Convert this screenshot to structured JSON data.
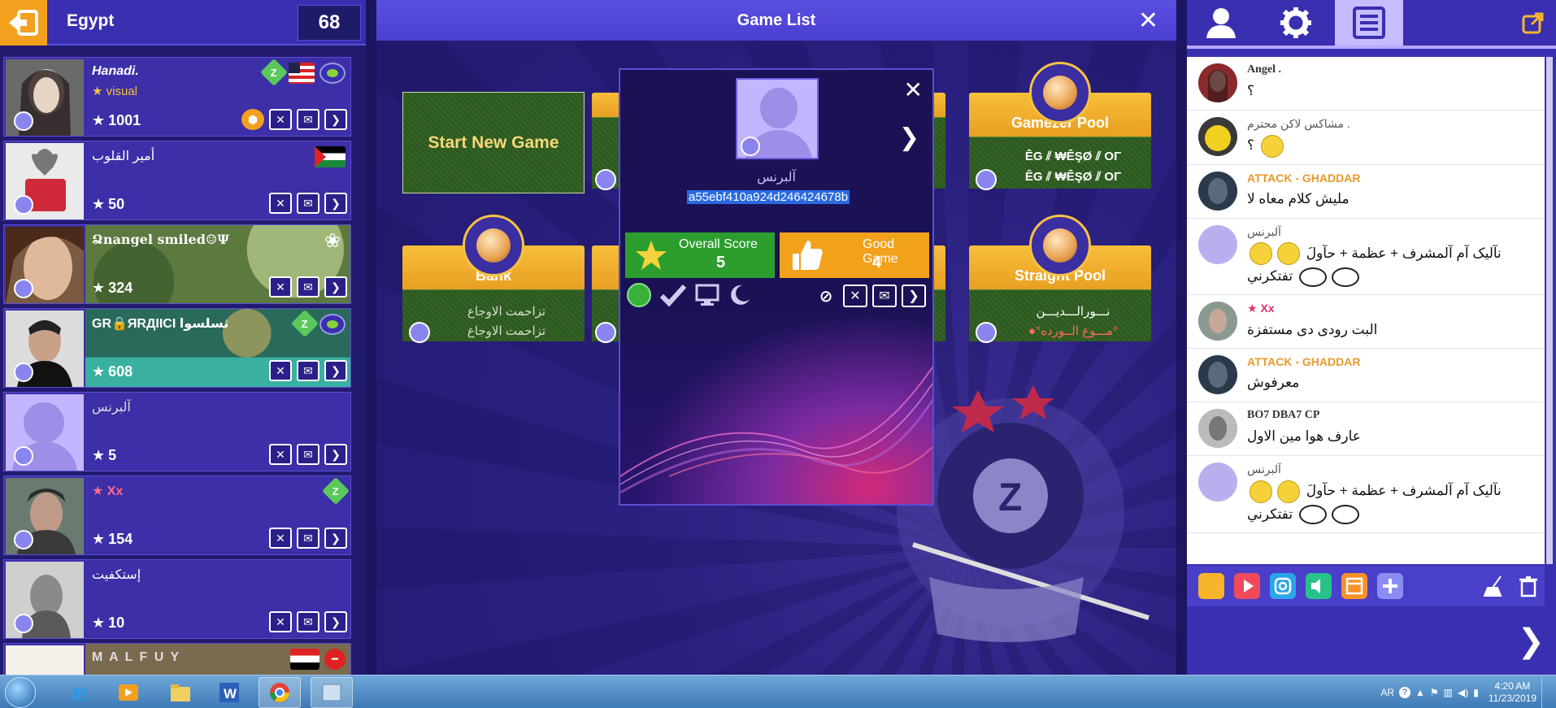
{
  "left_panel": {
    "room_name": "Egypt",
    "room_count": "68",
    "users": [
      {
        "name": "Hanadi.",
        "sub": "★ visual",
        "score": "1001",
        "italic": true
      },
      {
        "name": "أمير القلوب",
        "sub": "",
        "score": "50",
        "italic": false
      },
      {
        "name": "Ձnangel smiled☺Ψ",
        "sub": "",
        "score": "324",
        "italic": false
      },
      {
        "name": "GR🔒ЯRДIICI ثسلسوا",
        "sub": "",
        "score": "608",
        "italic": false
      },
      {
        "name": "آلبرنس",
        "sub": "",
        "score": "5",
        "italic": false
      },
      {
        "name": "★ Xx",
        "sub": "",
        "score": "154",
        "italic": false
      },
      {
        "name": "إستكفيت",
        "sub": "",
        "score": "10",
        "italic": false
      },
      {
        "name": "M A L F U Y",
        "sub": "",
        "score": "",
        "italic": false
      }
    ]
  },
  "center_panel": {
    "title": "Game List",
    "start_new_game": "Start New Game",
    "tiles": [
      {
        "label": "Gamezer Pool",
        "line1": "ÊG ⫽ ₩ÊŞØ ⫽ ОΓ",
        "line2": "ÊG ⫽ ₩ÊŞØ ⫽ ОΓ"
      },
      {
        "label": "Bank",
        "line1": "تزاحمت الاوجاع",
        "line2": "تزاحمت الاوجاع"
      },
      {
        "label": "Straight Pool",
        "line1": "نـــورالـــديـــن",
        "line2": "●°مـــوع الــورده°"
      }
    ],
    "profile_popup": {
      "name": "آلبرنس",
      "id": "a55ebf410a924d246424678b",
      "overall_score_label": "Overall Score",
      "overall_score": "5",
      "good_game_label": "Good Game",
      "good_game": "4"
    }
  },
  "right_panel": {
    "messages": [
      {
        "name": "Angel .",
        "text": "؟",
        "style": "dark"
      },
      {
        "name": "مشاكس لاكن محترم .",
        "text": "؟",
        "style": "plain"
      },
      {
        "name": "ATTACK - GHADDAR",
        "text": "مليش كلام معاه لا",
        "style": "bold"
      },
      {
        "name": "آلبرنس",
        "text": "نآليک آم آلمشرف + عظمة + حآولَ",
        "text2": "تفتكرني",
        "style": "plain"
      },
      {
        "name": "★ Xx",
        "text": "البت رودى دى مستفزة",
        "style": "pink"
      },
      {
        "name": "ATTACK - GHADDAR",
        "text": "معرفوش",
        "style": "bold"
      },
      {
        "name": "BO7 DBA7 CP",
        "text": "عارف هوا مين الاول",
        "style": "dark"
      },
      {
        "name": "آلبرنس",
        "text": "نآليک آم آلمشرف + عظمة + حآولَ",
        "text2": "تفتكرني",
        "style": "plain"
      }
    ]
  },
  "taskbar": {
    "lang": "AR",
    "time": "4:20 AM",
    "date": "11/23/2019"
  },
  "colors": {
    "accent_orange": "#f2a01e",
    "panel_blue": "#3a2fb0",
    "felt_green": "#2c5a1e",
    "score_green": "#2c9e2e"
  }
}
